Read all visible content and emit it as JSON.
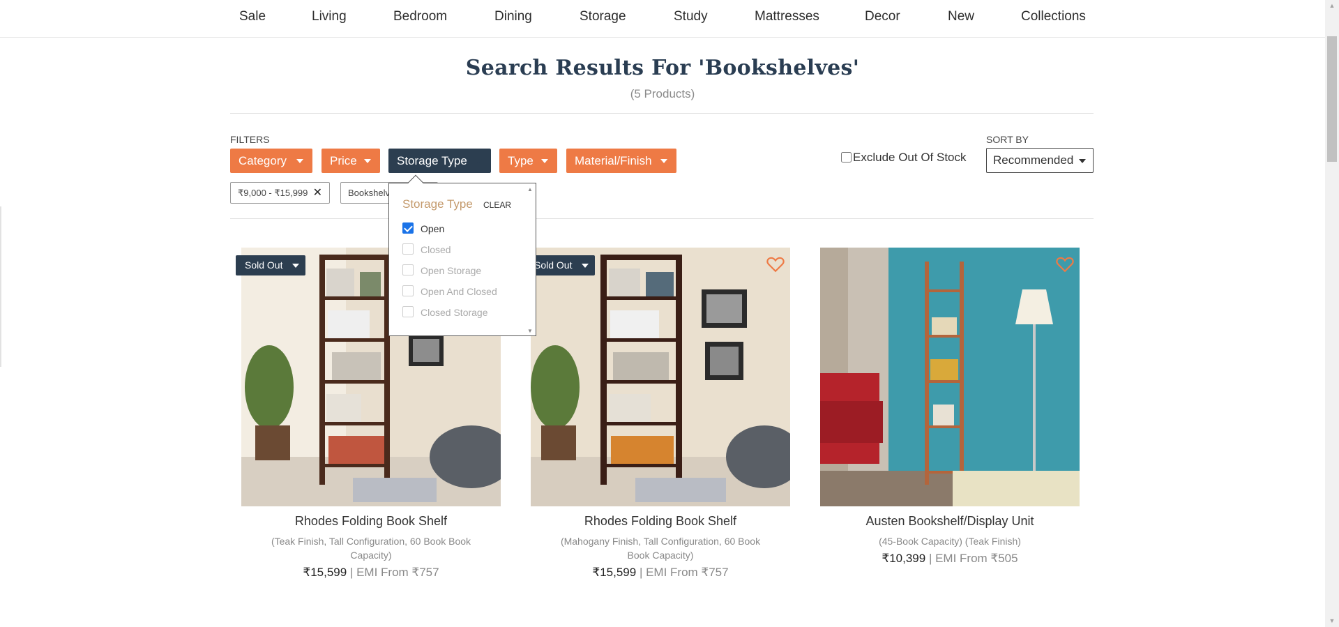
{
  "nav": {
    "items": [
      "Sale",
      "Living",
      "Bedroom",
      "Dining",
      "Storage",
      "Study",
      "Mattresses",
      "Decor",
      "New",
      "Collections"
    ]
  },
  "page": {
    "title": "Search Results For 'Bookshelves'",
    "count": "(5 Products)"
  },
  "filters": {
    "label": "FILTERS",
    "buttons": [
      "Category",
      "Price",
      "Storage Type",
      "Type",
      "Material/Finish"
    ],
    "active": "Storage Type",
    "exclude_label": "Exclude Out Of Stock",
    "exclude_checked": false,
    "chips": [
      "₹9,000 - ₹15,999",
      "Bookshelv"
    ]
  },
  "sort": {
    "label": "SORT BY",
    "value": "Recommended"
  },
  "dropdown": {
    "title": "Storage Type",
    "clear": "CLEAR",
    "options": [
      {
        "label": "Open",
        "checked": true
      },
      {
        "label": "Closed",
        "checked": false
      },
      {
        "label": "Open Storage",
        "checked": false
      },
      {
        "label": "Open And Closed",
        "checked": false
      },
      {
        "label": "Closed Storage",
        "checked": false
      }
    ]
  },
  "products": [
    {
      "name": "Rhodes Folding Book Shelf",
      "desc": "(Teak Finish, Tall Configuration, 60 Book Book Capacity)",
      "price": "₹15,599",
      "emi": " | EMI From ₹757",
      "badge": "Sold Out"
    },
    {
      "name": "Rhodes Folding Book Shelf",
      "desc": "(Mahogany Finish, Tall Configuration, 60 Book Book Capacity)",
      "price": "₹15,599",
      "emi": " | EMI From ₹757",
      "badge": "Sold Out"
    },
    {
      "name": "Austen Bookshelf/Display Unit",
      "desc": "(45-Book Capacity) (Teak Finish)",
      "price": "₹10,399",
      "emi": " | EMI From ₹505",
      "badge": ""
    }
  ],
  "colors": {
    "accent": "#ee7a45",
    "dark": "#2c3e50",
    "title": "#2a3d52",
    "dropdown_title": "#c49a6c"
  }
}
